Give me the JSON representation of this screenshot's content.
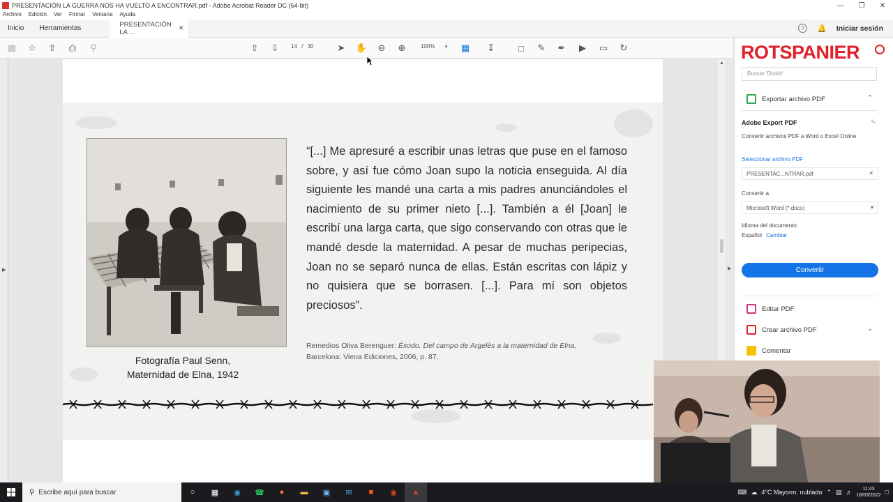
{
  "window": {
    "title": "PRESENTACIÓN LA GUERRA NOS HA VUELTO A ENCONTRAR.pdf - Adobe Acrobat Reader DC (64-bit)",
    "menu": [
      "Archivo",
      "Edición",
      "Ver",
      "Firmar",
      "Ventana",
      "Ayuda"
    ]
  },
  "tabs": {
    "home": "Inicio",
    "tools": "Herramientas",
    "document": "PRESENTACIÓN LA ...",
    "help_icon": "?",
    "sign_in": "Iniciar sesión"
  },
  "toolbar": {
    "current_page": "14",
    "separator": "/",
    "total_pages": "30",
    "zoom": "100%"
  },
  "slide": {
    "quote": "“[...] Me apresuré a escribir unas letras que puse en el famoso sobre, y así fue cómo Joan supo la noticia enseguida. Al día siguiente les mandé una carta a mis padres anunciándoles el nacimiento de su primer nieto [...]. También a él [Joan] le escribí una larga carta, que sigo conservando con otras que le mandé desde la maternidad. A pesar de muchas peripecias, Joan no se separó nunca de ellas. Están escritas con lápiz y no quisiera que se borrasen. [...]. Para mí son objetos preciosos”.",
    "citation_author": "Remedios Oliva Berenguer:",
    "citation_title": "Éxodo. Del campo de Argelès a la maternidad de Elna,",
    "citation_rest": "Barcelona: Viena Ediciones, 2006, p. 87.",
    "caption_line1": "Fotografía Paul Senn,",
    "caption_line2": "Maternidad de Elna, 1942"
  },
  "right_panel": {
    "logo": "ROTSPANIER",
    "search_placeholder": "Buscar 'Dividir'",
    "export_header": "Exportar archivo PDF",
    "export_title": "Adobe Export PDF",
    "export_desc": "Convertir archivos PDF a Word o Excel Online",
    "select_label": "Seleccionar archivo PDF",
    "selected_file": "PRESENTAC...NTRAR.pdf",
    "convert_to_label": "Convertir a",
    "convert_to_value": "Microsoft Word (*.docx)",
    "language_label": "Idioma del documento:",
    "language_value": "Español",
    "language_change": "Cambiar",
    "convert_button": "Convertir",
    "edit_pdf": "Editar PDF",
    "create_pdf": "Crear archivo PDF",
    "comment": "Comentar"
  },
  "taskbar": {
    "search_placeholder": "Escribe aquí para buscar",
    "weather": "4°C  Mayorm. nublado",
    "time": "11:43",
    "date": "18/03/2022"
  },
  "colors": {
    "brand_red": "#e0202a",
    "accent_blue": "#1473e6",
    "acrobat_red": "#d3322f"
  }
}
